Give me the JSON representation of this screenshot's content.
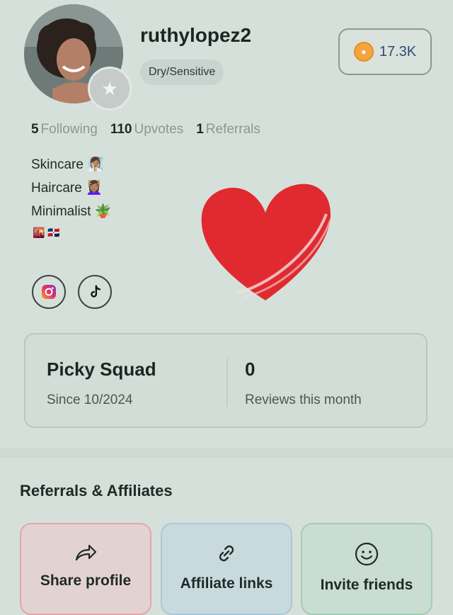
{
  "profile": {
    "username": "ruthylopez2",
    "skin_type": "Dry/Sensitive",
    "coins": "17.3K"
  },
  "stats": [
    {
      "value": "5",
      "label": "Following"
    },
    {
      "value": "110",
      "label": "Upvotes"
    },
    {
      "value": "1",
      "label": "Referrals"
    }
  ],
  "bio": {
    "lines": [
      "Skincare 🧖🏽‍♀️",
      "Haircare 💆🏽‍♀️",
      "Minimalist 🪴"
    ],
    "flags": "🌇 🇩🇴"
  },
  "social": {
    "instagram_icon": "instagram-icon",
    "tiktok_icon": "tiktok-icon"
  },
  "squad": {
    "title": "Picky Squad",
    "since": "Since 10/2024",
    "reviews_count": "0",
    "reviews_label": "Reviews this month"
  },
  "referrals": {
    "title": "Referrals & Affiliates",
    "tiles": [
      {
        "label": "Share profile",
        "icon": "share-arrow-icon"
      },
      {
        "label": "Affiliate links",
        "icon": "link-icon"
      },
      {
        "label": "Invite friends",
        "icon": "smiley-icon"
      }
    ]
  },
  "colors": {
    "background": "#d6e0da",
    "coin": "#f3a53f",
    "heart": "#e02a30",
    "share_tile_border": "#e0a7ab",
    "affiliate_tile_border": "#a9c8d8",
    "invite_tile_border": "#a4cdb5"
  }
}
